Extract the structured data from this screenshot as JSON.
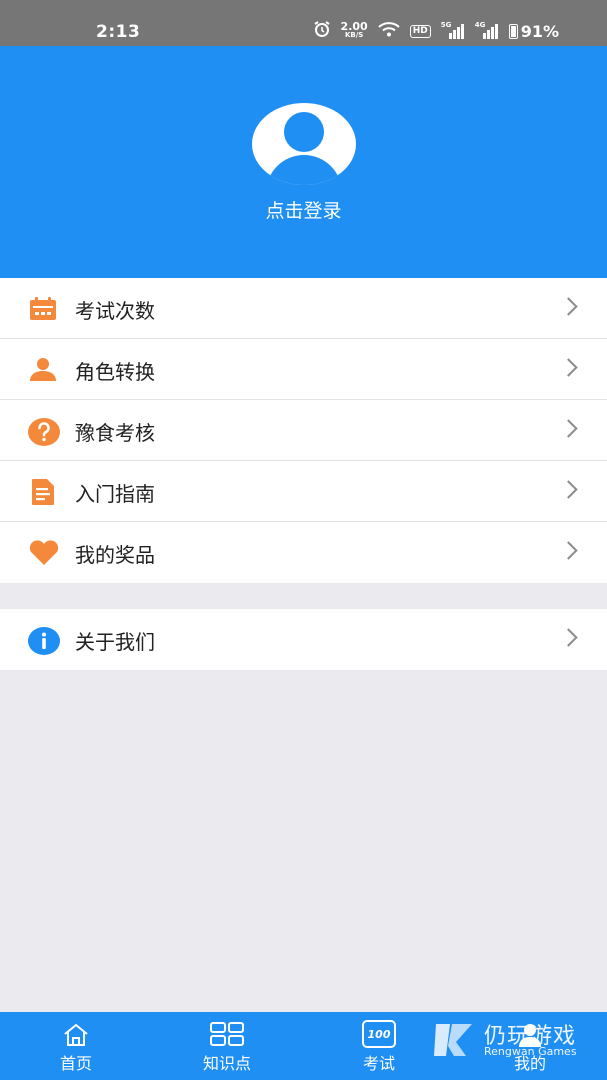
{
  "status_bar": {
    "time": "2:13",
    "speed_value": "2.00",
    "speed_unit": "KB/S",
    "hd_label": "HD",
    "signal1_tag": "5G",
    "signal2_tag": "4G",
    "battery": "91%"
  },
  "profile": {
    "login_label": "点击登录"
  },
  "menu": {
    "items": [
      {
        "label": "考试次数",
        "icon": "calendar-icon"
      },
      {
        "label": "角色转换",
        "icon": "person-icon"
      },
      {
        "label": "豫食考核",
        "icon": "question-icon"
      },
      {
        "label": "入门指南",
        "icon": "document-icon"
      },
      {
        "label": "我的奖品",
        "icon": "heart-icon"
      }
    ],
    "about": {
      "label": "关于我们",
      "icon": "info-icon"
    }
  },
  "tabbar": {
    "tabs": [
      {
        "label": "首页",
        "icon": "home-icon"
      },
      {
        "label": "知识点",
        "icon": "grid-icon"
      },
      {
        "label": "考试",
        "icon": "exam-100-icon"
      },
      {
        "label": "我的",
        "icon": "profile-icon"
      }
    ],
    "exam_icon_text": "100"
  },
  "watermark": {
    "title": "仍玩游戏",
    "subtitle": "Rengwan Games"
  },
  "colors": {
    "primary": "#1f8ff4",
    "accent_orange": "#f5893b",
    "status_bar": "#767676",
    "background": "#ebebef"
  }
}
